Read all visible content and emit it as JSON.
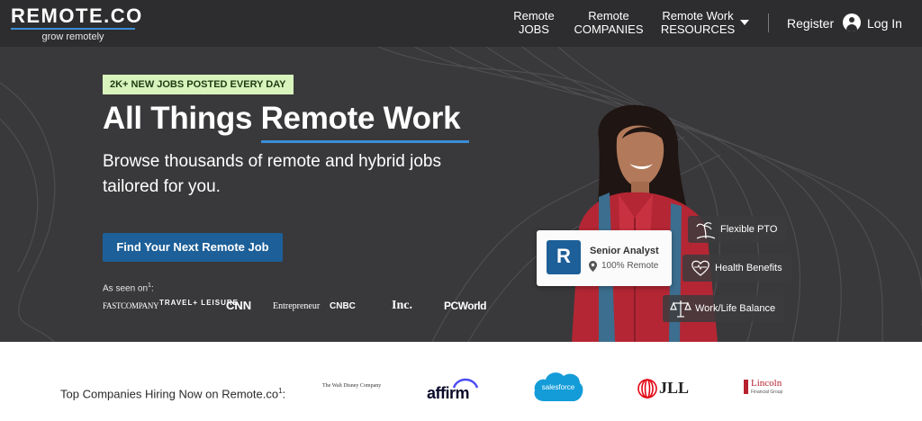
{
  "nav": {
    "logo_word": "REMOTE.CO",
    "logo_tag": "grow remotely",
    "items": [
      {
        "line1": "Remote",
        "line2": "JOBS"
      },
      {
        "line1": "Remote",
        "line2": "COMPANIES"
      },
      {
        "line1": "Remote Work",
        "line2": "RESOURCES"
      }
    ],
    "register": "Register",
    "login": "Log In"
  },
  "hero": {
    "badge": "2K+ NEW JOBS POSTED EVERY DAY",
    "title": "All Things Remote Work",
    "subtitle": "Browse thousands of remote and hybrid jobs tailored for you.",
    "cta": "Find Your Next Remote Job",
    "seen_on": "As seen on",
    "seen_on_sup": "1",
    "seen_on_colon": ":",
    "media": [
      "FASTCOMPANY",
      "TRAVEL+ LEISURE",
      "CNN",
      "Entrepreneur",
      "CNBC",
      "Inc.",
      "PCWorld"
    ],
    "job_card": {
      "logo": "R",
      "title": "Senior Analyst",
      "location": "100% Remote"
    },
    "perks": [
      "Flexible PTO",
      "Health Benefits",
      "Work/Life Balance"
    ]
  },
  "companies": {
    "label": "Top Companies Hiring Now on Remote.co",
    "label_sup": "1",
    "label_colon": ":",
    "logos": [
      "The Walt Disney Company",
      "affirm",
      "salesforce",
      "JLL",
      "Lincoln",
      "Financial Group"
    ]
  },
  "colors": {
    "nav_bg": "#2d2d2f",
    "hero_bg": "#39393b",
    "accent_blue": "#3c8dd6",
    "cta_blue": "#1d5f98",
    "badge_green": "#d9f3bd"
  }
}
